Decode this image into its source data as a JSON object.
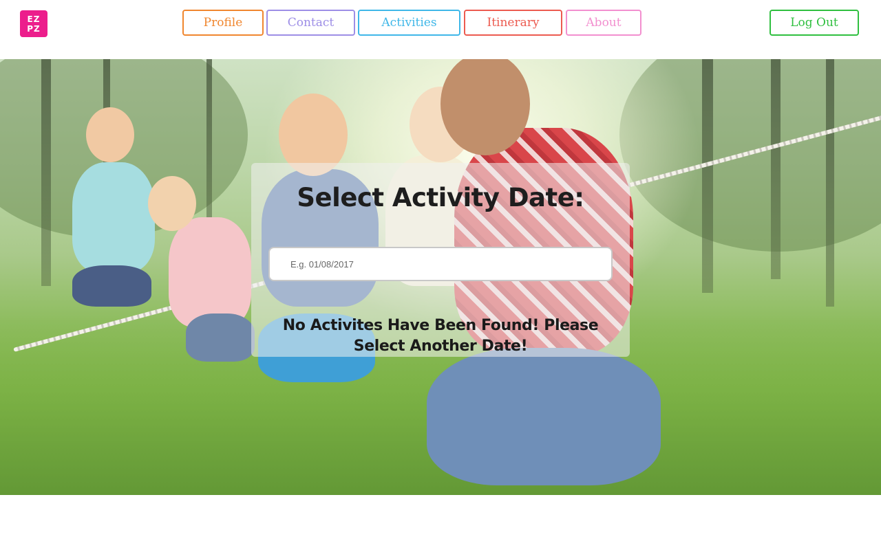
{
  "logo": {
    "line1": "EZ",
    "line2": "PZ",
    "color": "#ec1e8c"
  },
  "nav": {
    "items": [
      {
        "label": "Profile",
        "color": "#f0862e"
      },
      {
        "label": "Contact",
        "color": "#9d8ee6"
      },
      {
        "label": "Activities",
        "color": "#3fb7e8"
      },
      {
        "label": "Itinerary",
        "color": "#ec5a4f"
      },
      {
        "label": "About",
        "color": "#f28fcf"
      }
    ],
    "logout": {
      "label": "Log Out",
      "color": "#2fbf3f"
    }
  },
  "main": {
    "title": "Select Activity Date:",
    "date_input": {
      "placeholder": "E.g. 01/08/2017",
      "value": ""
    },
    "message": "No Activites Have Been Found! Please Select Another Date!"
  },
  "hero": {
    "image": "kids-tug-of-war"
  }
}
